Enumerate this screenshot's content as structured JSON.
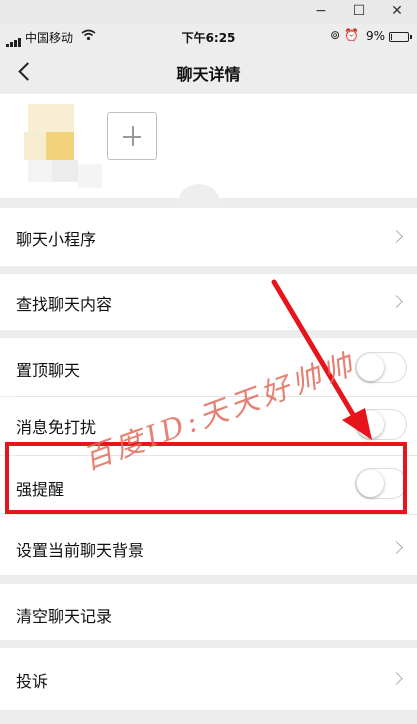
{
  "window": {
    "minimize_glyph": "−",
    "maximize_glyph": "☐",
    "close_glyph": "✕"
  },
  "status_bar": {
    "carrier": "中国移动",
    "time": "下午6:25",
    "battery_percent": "9%",
    "battery_level": 0.09,
    "icons": [
      "signal-icon",
      "wifi-icon",
      "lock-rotation-icon",
      "alarm-icon",
      "battery-icon"
    ]
  },
  "nav": {
    "title": "聊天详情",
    "back_icon": "chevron-left-icon"
  },
  "members": {
    "add_icon": "plus-icon"
  },
  "rows": {
    "mini_programs": "聊天小程序",
    "search_history": "查找聊天内容",
    "sticky_chat": "置顶聊天",
    "do_not_disturb": "消息免打扰",
    "strong_reminder": "强提醒",
    "set_background": "设置当前聊天背景",
    "clear_history": "清空聊天记录",
    "report": "投诉"
  },
  "toggles": {
    "sticky_chat": false,
    "do_not_disturb": false,
    "strong_reminder": false
  },
  "watermark": {
    "text": "百度ID:天天好帅帅"
  },
  "colors": {
    "highlight": "#e8141b",
    "watermark": "#e26a5a",
    "background": "#ededed"
  }
}
